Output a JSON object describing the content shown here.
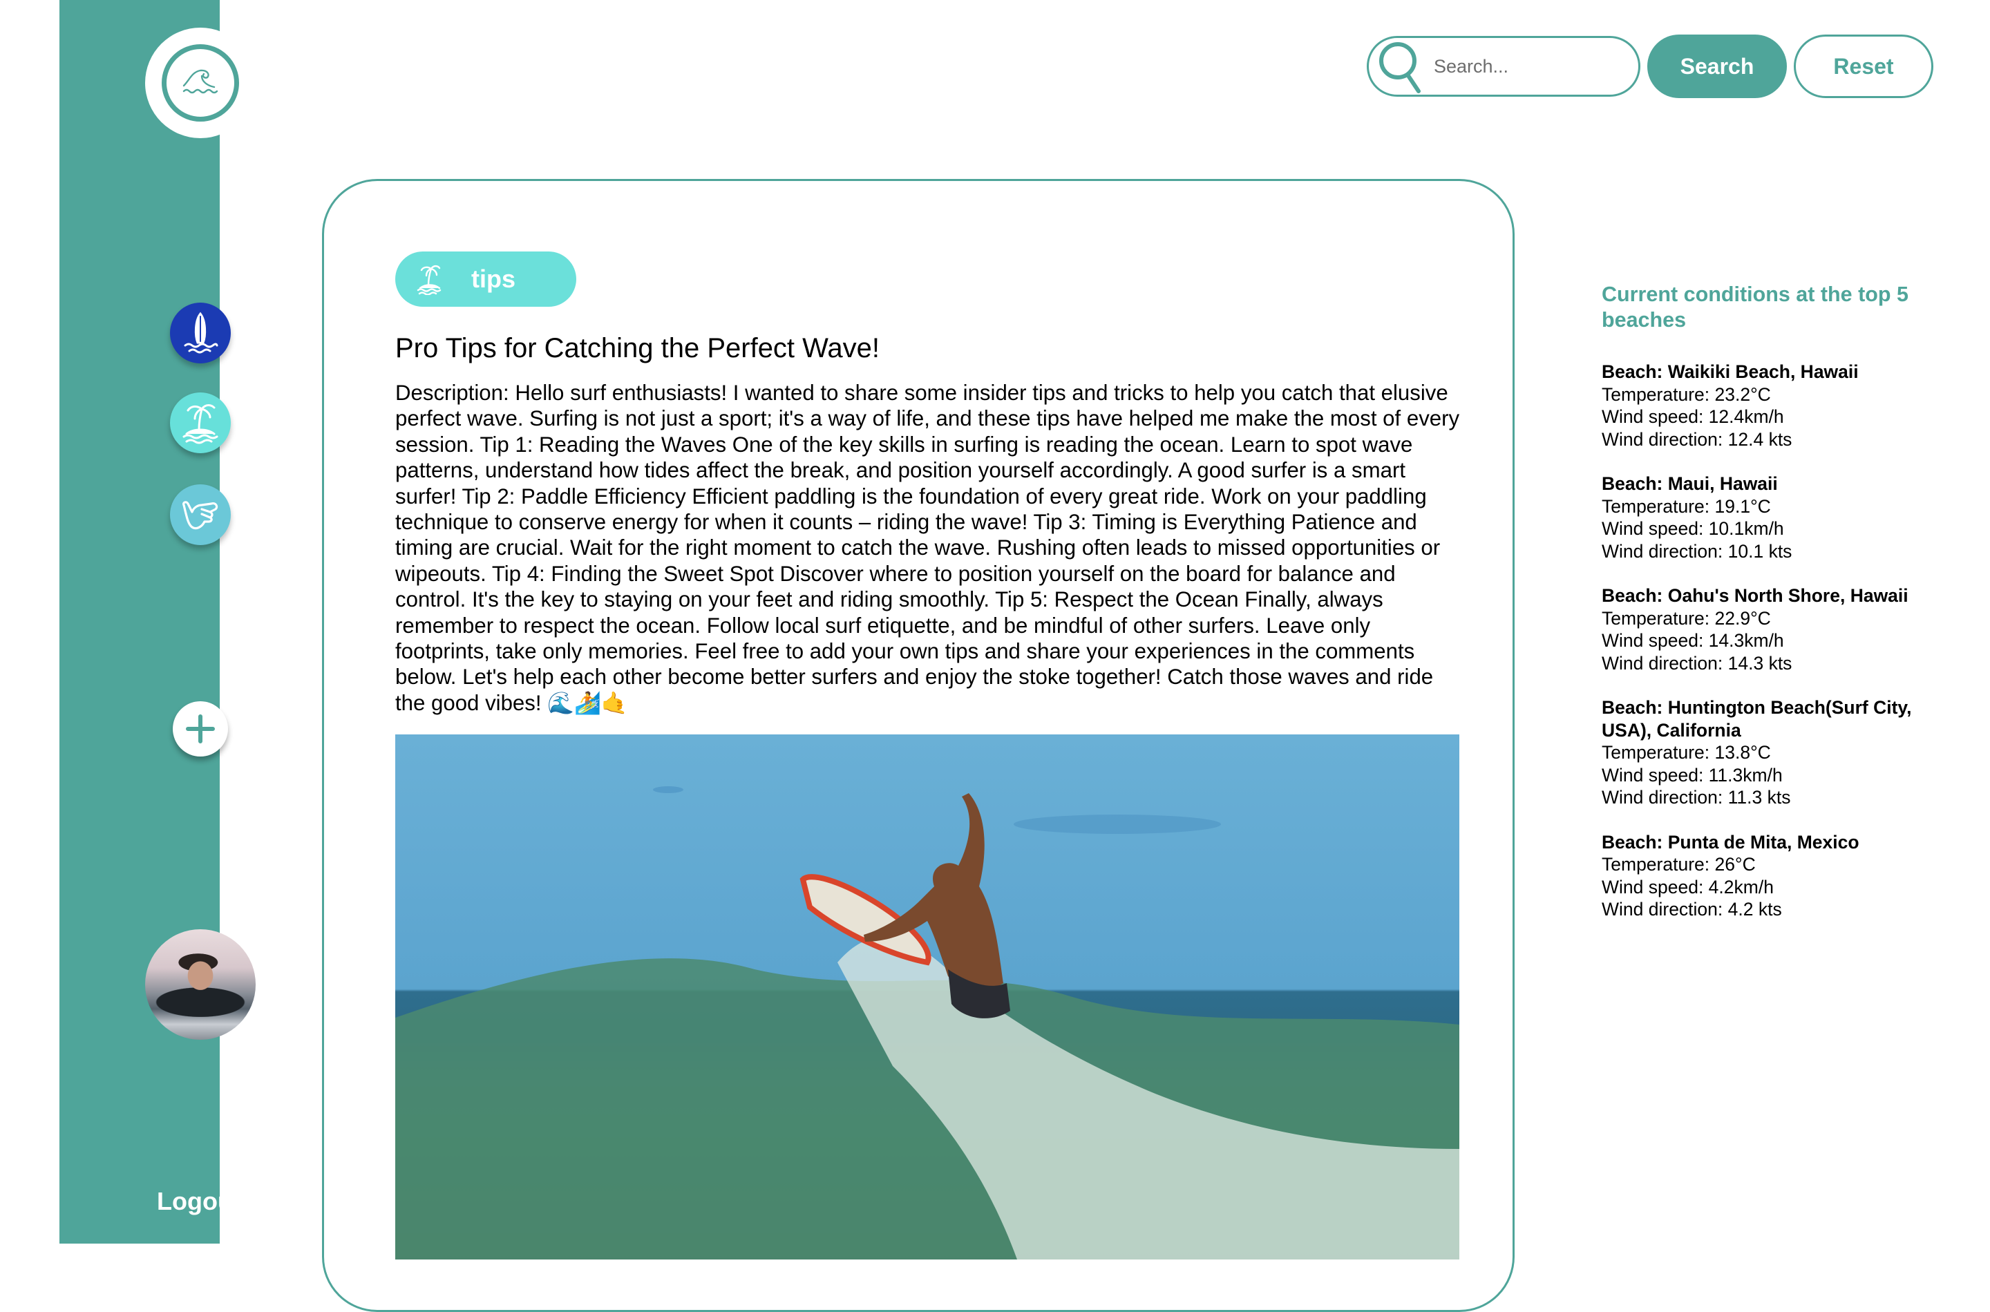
{
  "sidebar": {
    "logo_icon": "wave-icon",
    "nav": [
      {
        "name": "surfboards",
        "icon": "surfboard-icon",
        "color": "#1B3BB3"
      },
      {
        "name": "beaches",
        "icon": "palm-island-icon",
        "color": "#67E0DA"
      },
      {
        "name": "tips",
        "icon": "shaka-hand-icon",
        "color": "#6BC8D8"
      }
    ],
    "add_icon": "plus-icon",
    "avatar_alt": "user avatar",
    "logout_label": "Logout",
    "background": "#4FA59A"
  },
  "header": {
    "search_placeholder": "Search...",
    "search_value": "",
    "search_button": "Search",
    "reset_button": "Reset"
  },
  "post": {
    "tag_label": "tips",
    "tag_icon": "palm-island-icon",
    "title": "Pro Tips for Catching the Perfect Wave!",
    "description": "Description: Hello surf enthusiasts! I wanted to share some insider tips and tricks to help you catch that elusive perfect wave. Surfing is not just a sport; it's a way of life, and these tips have helped me make the most of every session. Tip 1: Reading the Waves One of the key skills in surfing is reading the ocean. Learn to spot wave patterns, understand how tides affect the break, and position yourself accordingly. A good surfer is a smart surfer! Tip 2: Paddle Efficiency Efficient paddling is the foundation of every great ride. Work on your paddling technique to conserve energy for when it counts – riding the wave!  Tip 3: Timing is Everything Patience and timing are crucial. Wait for the right moment to catch the wave. Rushing often leads to missed opportunities or wipeouts.  Tip 4: Finding the Sweet Spot Discover where to position yourself on the board for balance and control. It's the key to staying on your feet and riding smoothly.  Tip 5: Respect the Ocean Finally, always remember to respect the ocean. Follow local surf etiquette, and be mindful of other surfers. Leave only footprints, take only memories. Feel free to add your own tips and share your experiences in the comments below. Let's help each other become better surfers and enjoy the stoke together! Catch those waves and ride the good vibes! 🌊🏄🤙",
    "image_alt": "surfer riding a wave"
  },
  "conditions": {
    "heading": "Current conditions at the top 5 beaches",
    "beaches": [
      {
        "name": "Beach: Waikiki Beach, Hawaii",
        "temperature": "Temperature: 23.2°C",
        "wind_speed": "Wind speed: 12.4km/h",
        "wind_direction": "Wind direction: 12.4 kts"
      },
      {
        "name": "Beach: Maui, Hawaii",
        "temperature": "Temperature: 19.1°C",
        "wind_speed": "Wind speed: 10.1km/h",
        "wind_direction": "Wind direction: 10.1 kts"
      },
      {
        "name": "Beach: Oahu's North Shore, Hawaii",
        "temperature": "Temperature: 22.9°C",
        "wind_speed": "Wind speed: 14.3km/h",
        "wind_direction": "Wind direction: 14.3 kts"
      },
      {
        "name": "Beach: Huntington Beach(Surf City, USA), California",
        "temperature": "Temperature: 13.8°C",
        "wind_speed": "Wind speed: 11.3km/h",
        "wind_direction": "Wind direction: 11.3 kts"
      },
      {
        "name": "Beach: Punta de Mita, Mexico",
        "temperature": "Temperature: 26°C",
        "wind_speed": "Wind speed: 4.2km/h",
        "wind_direction": "Wind direction: 4.2 kts"
      }
    ]
  },
  "colors": {
    "accent": "#4FA59A",
    "tag": "#6BE0DA",
    "surf_icon_bg": "#1B3BB3"
  }
}
